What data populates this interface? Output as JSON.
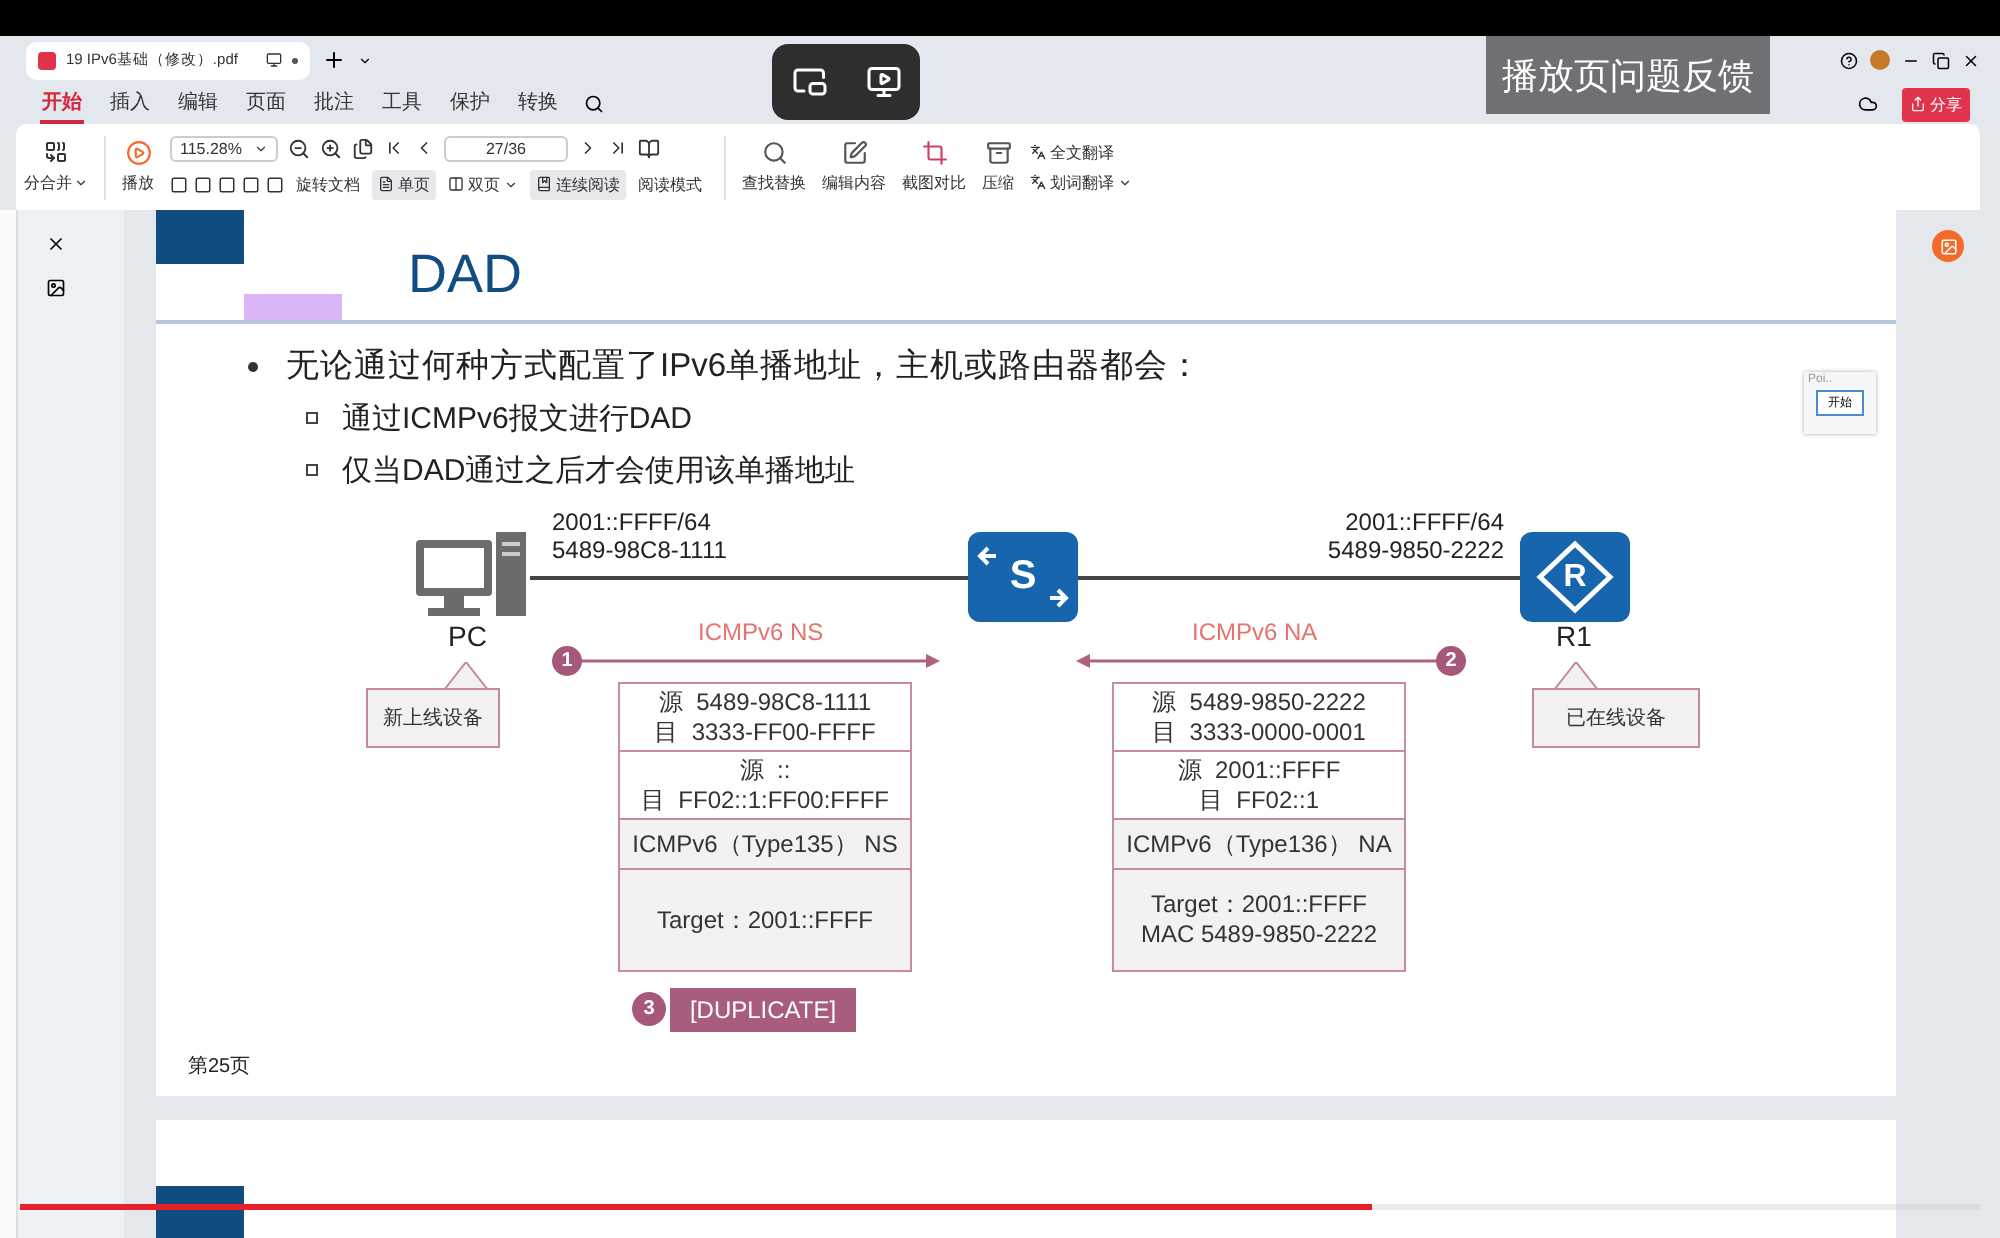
{
  "doc_tab": {
    "title": "19 IPv6基础（修改）.pdf"
  },
  "menu": [
    {
      "label": "开始",
      "selected": true
    },
    {
      "label": "插入",
      "selected": false
    },
    {
      "label": "编辑",
      "selected": false
    },
    {
      "label": "页面",
      "selected": false
    },
    {
      "label": "批注",
      "selected": false
    },
    {
      "label": "工具",
      "selected": false
    },
    {
      "label": "保护",
      "selected": false
    },
    {
      "label": "转换",
      "selected": false
    }
  ],
  "share": "分享",
  "toolbar": {
    "merge": "分合并",
    "play": "播放",
    "zoom": "115.28%",
    "page": "27/36",
    "view_items": [
      {
        "label": "旋转文档",
        "selected": false
      },
      {
        "label": "单页",
        "selected": true
      },
      {
        "label": "双页",
        "selected": false
      },
      {
        "label": "连续阅读",
        "selected": true
      },
      {
        "label": "阅读模式",
        "selected": false
      }
    ],
    "tools": [
      "查找替换",
      "编辑内容",
      "截图对比",
      "压缩"
    ],
    "translate": [
      "全文翻译",
      "划词翻译"
    ]
  },
  "feedback": "播放页问题反馈",
  "popup": {
    "title": "Poi..",
    "button": "开始"
  },
  "slide": {
    "title": "DAD",
    "bullet": "无论通过何种方式配置了IPv6单播地址，主机或路由器都会：",
    "sub_bullets": [
      "通过ICMPv6报文进行DAD",
      "仅当DAD通过之后才会使用该单播地址"
    ],
    "left_node": {
      "label": "PC",
      "addr": [
        "2001::FFFF/64",
        "5489-98C8-1111"
      ],
      "callout": "新上线设备"
    },
    "switch": {
      "glyph": "S"
    },
    "right_node": {
      "label": "R1",
      "glyph": "R",
      "addr": [
        "2001::FFFF/64",
        "5489-9850-2222"
      ],
      "callout": "已在线设备"
    },
    "messages": [
      {
        "step": "1",
        "label": "ICMPv6 NS",
        "kind": "rightward",
        "rows": [
          [
            "源  5489-98C8-1111",
            "目  3333-FF00-FFFF"
          ],
          [
            "源  ::",
            "目  FF02::1:FF00:FFFF"
          ],
          [
            "ICMPv6（Type135） NS"
          ],
          [
            "Target：2001::FFFF"
          ]
        ]
      },
      {
        "step": "2",
        "label": "ICMPv6 NA",
        "kind": "leftward",
        "rows": [
          [
            "源  5489-9850-2222",
            "目  3333-0000-0001"
          ],
          [
            "源  2001::FFFF",
            "目  FF02::1"
          ],
          [
            "ICMPv6（Type136） NA"
          ],
          [
            "Target：2001::FFFF",
            "MAC 5489-9850-2222"
          ]
        ]
      }
    ],
    "result": {
      "step": "3",
      "label": "[DUPLICATE]"
    },
    "page_number": "第25页"
  },
  "video": {
    "level": 0.69
  }
}
